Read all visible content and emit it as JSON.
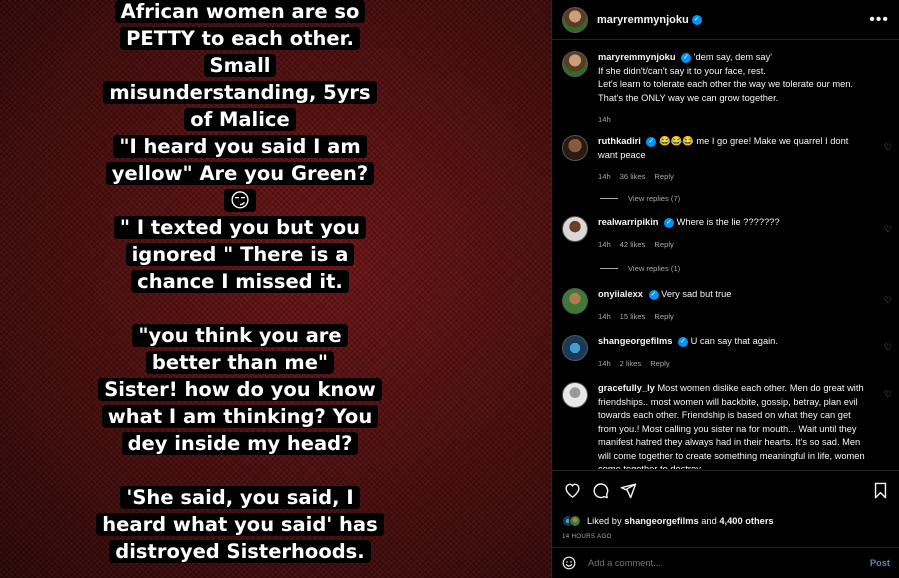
{
  "post_image": {
    "lines": [
      "African women are so",
      "PETTY to each other.",
      "Small",
      "misunderstanding, 5yrs",
      "of Malice",
      "\"I heard you said I am",
      "yellow\"  Are you Green?",
      "😏",
      "\" I texted you but you",
      "ignored \" There is a",
      "chance I missed it.",
      "",
      "\"you think you are",
      "better than me\"",
      "Sister! how do you know",
      "what I am thinking? You",
      "dey inside my head?",
      "",
      "'She said, you said, I",
      "heard what you said' has",
      "distroyed Sisterhoods."
    ]
  },
  "header": {
    "username": "maryremmynjoku",
    "more_icon": "more-horizontal-icon"
  },
  "caption": {
    "username": "maryremmynjoku",
    "text_line1": "'dem say, dem say'",
    "text_rest": "If she didn't/can't say it to your face, rest.\nLet's learn to tolerate each other the way we tolerate our men.\nThat's the ONLY way we can grow together.",
    "time": "14h"
  },
  "comments": [
    {
      "username": "ruthkadiri",
      "verified": true,
      "text": "😂😂😂 me I go gree! Make we quarrel I dont want peace",
      "time": "14h",
      "likes": "36 likes",
      "reply": "Reply",
      "view_replies": "View replies (7)"
    },
    {
      "username": "realwarripikin",
      "verified": true,
      "text": "Where is the lie ???????",
      "time": "14h",
      "likes": "42 likes",
      "reply": "Reply",
      "view_replies": "View replies (1)"
    },
    {
      "username": "onyiialexx",
      "verified": true,
      "text": "Very sad but true",
      "time": "14h",
      "likes": "15 likes",
      "reply": "Reply"
    },
    {
      "username": "shangeorgefilms",
      "verified": true,
      "text": "U can say that again.",
      "time": "14h",
      "likes": "2 likes",
      "reply": "Reply"
    },
    {
      "username": "gracefully_ly",
      "verified": false,
      "text": "Most women dislike each other. Men do great with friendships.. most women will backbite, gossip, betray, plan evil towards each other. Friendship is based on what they can get from you.! Most calling you sister na for mouth... Wait until they manifest hatred they always had in their hearts. It's so sad. Men will come together to create something meaningful in life, women come together to destroy..."
    }
  ],
  "liked_by": {
    "prefix": "Liked by",
    "user": "shangeorgefilms",
    "middle": "and",
    "others": "4,400 others"
  },
  "timestamp": "14 HOURS AGO",
  "add_comment": {
    "placeholder": "Add a comment...",
    "post_label": "Post"
  }
}
